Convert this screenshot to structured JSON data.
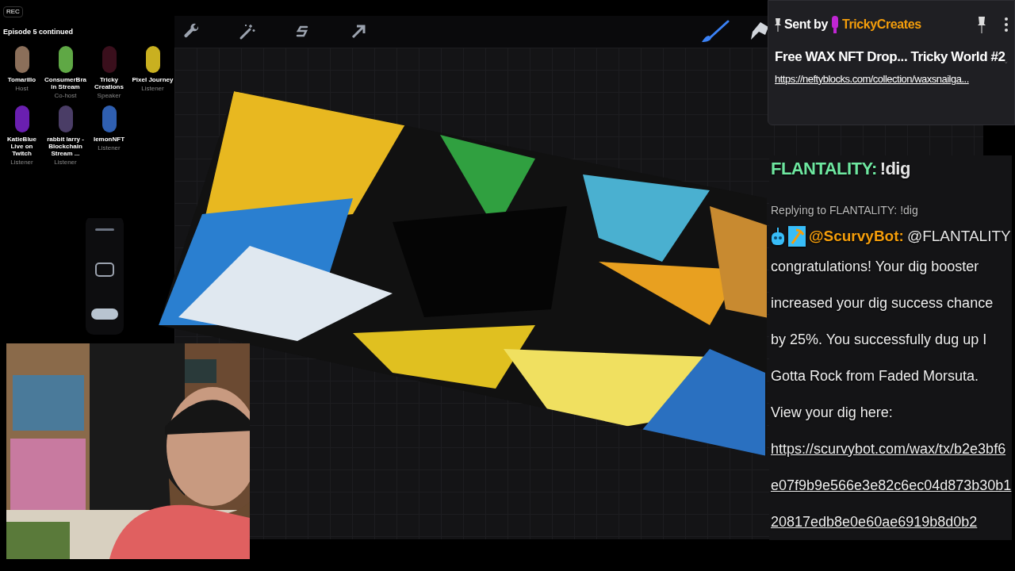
{
  "spaces_panel": {
    "badge": "REC",
    "title": "Episode 5 continued",
    "participants": [
      {
        "name": "Tomarillo",
        "role": "Host",
        "color": "#8b6f5a"
      },
      {
        "name": "ConsumerBrain Stream",
        "role": "Co-host",
        "color": "#5fa845"
      },
      {
        "name": "Tricky Creations",
        "role": "Speaker",
        "color": "#3a0f1c"
      },
      {
        "name": "Pixel Journey",
        "role": "Listener",
        "color": "#c9b020"
      },
      {
        "name": "KatieBlue Live on Twitch",
        "role": "Listener",
        "color": "#6a1fb0"
      },
      {
        "name": "rabbit larry - Blockchain Stream ...",
        "role": "Listener",
        "color": "#4a3d66"
      },
      {
        "name": "lemonNFT",
        "role": "Listener",
        "color": "#2f5fb0"
      }
    ]
  },
  "pinned": {
    "sent_by": "Sent by",
    "user": "TrickyCreates",
    "message": "Free WAX NFT Drop... Tricky World #2",
    "link": "https://neftyblocks.com/collection/waxsnailga..."
  },
  "chat": [
    {
      "kind": "message",
      "user": "FLANTALITY:",
      "text": "!dig",
      "color": "#6ee7a0"
    },
    {
      "kind": "reply",
      "reply_to": "Replying to FLANTALITY: !dig",
      "user": "@ScurvyBot:",
      "mention": "@FLANTALITY",
      "text": "congratulations! Your dig booster increased your dig success chance by 25%. You successfully dug up I Gotta Rock from Faded Morsuta. View your dig here:",
      "link": "https://scurvybot.com/wax/tx/b2e3bf6e07f9b9e566e3e82c6ec04d873b30b120817edb8e0e60ae6919b8d0b2",
      "color": "#f59e0b"
    }
  ]
}
